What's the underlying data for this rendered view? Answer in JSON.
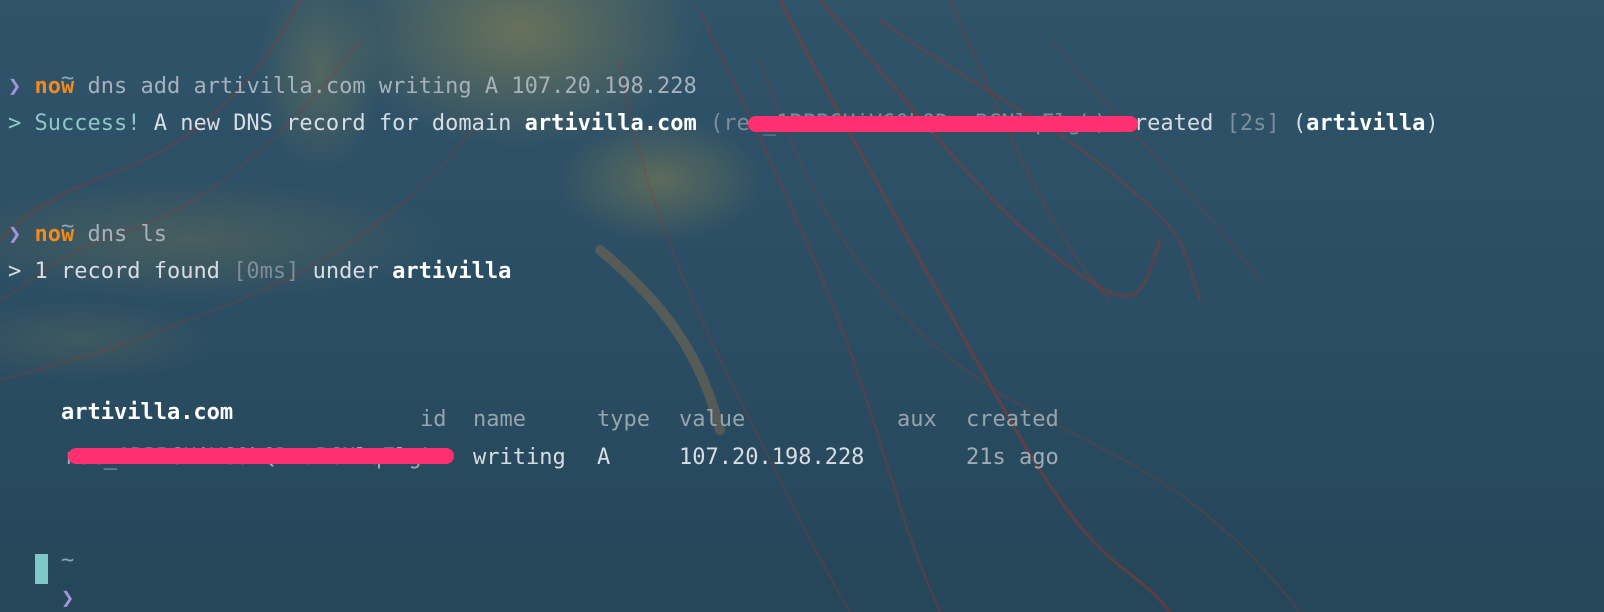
{
  "colors": {
    "command": "#f08a1e",
    "prompt": "#9f96d8",
    "success": "#8fc7c7",
    "redaction": "#ff2f70",
    "cursor": "#7ec8c8"
  },
  "block1": {
    "tilde": "~",
    "prompt": "❯",
    "command": "now",
    "args": "dns add artivilla.com writing A 107.20.198.228",
    "out_marker": ">",
    "out_success": "Success!",
    "out_text1": "A new DNS record for domain",
    "out_domain": "artivilla.com",
    "out_id_open": "(",
    "out_id": "rec_1RPB6HiV60hQDxuBCNlqFlgL",
    "out_id_close": ")",
    "out_created": "created",
    "out_time": "[2s]",
    "out_account_open": "(",
    "out_account": "artivilla",
    "out_account_close": ")"
  },
  "block2": {
    "tilde": "~",
    "prompt": "❯",
    "command": "now",
    "args": "dns ls",
    "out_marker": ">",
    "out_text1": "1 record found",
    "out_time": "[0ms]",
    "out_text2": "under",
    "out_account": "artivilla"
  },
  "records": {
    "domain": "artivilla.com",
    "headers": {
      "id": "id",
      "name": "name",
      "type": "type",
      "value": "value",
      "aux": "aux",
      "created": "created"
    },
    "rows": [
      {
        "id": "rec_1RPB6HiV60hQDxuBCNlqFlgL",
        "name": "writing",
        "type": "A",
        "value": "107.20.198.228",
        "aux": "",
        "created": "21s ago"
      }
    ]
  },
  "block3": {
    "tilde": "~",
    "prompt": "❯"
  }
}
